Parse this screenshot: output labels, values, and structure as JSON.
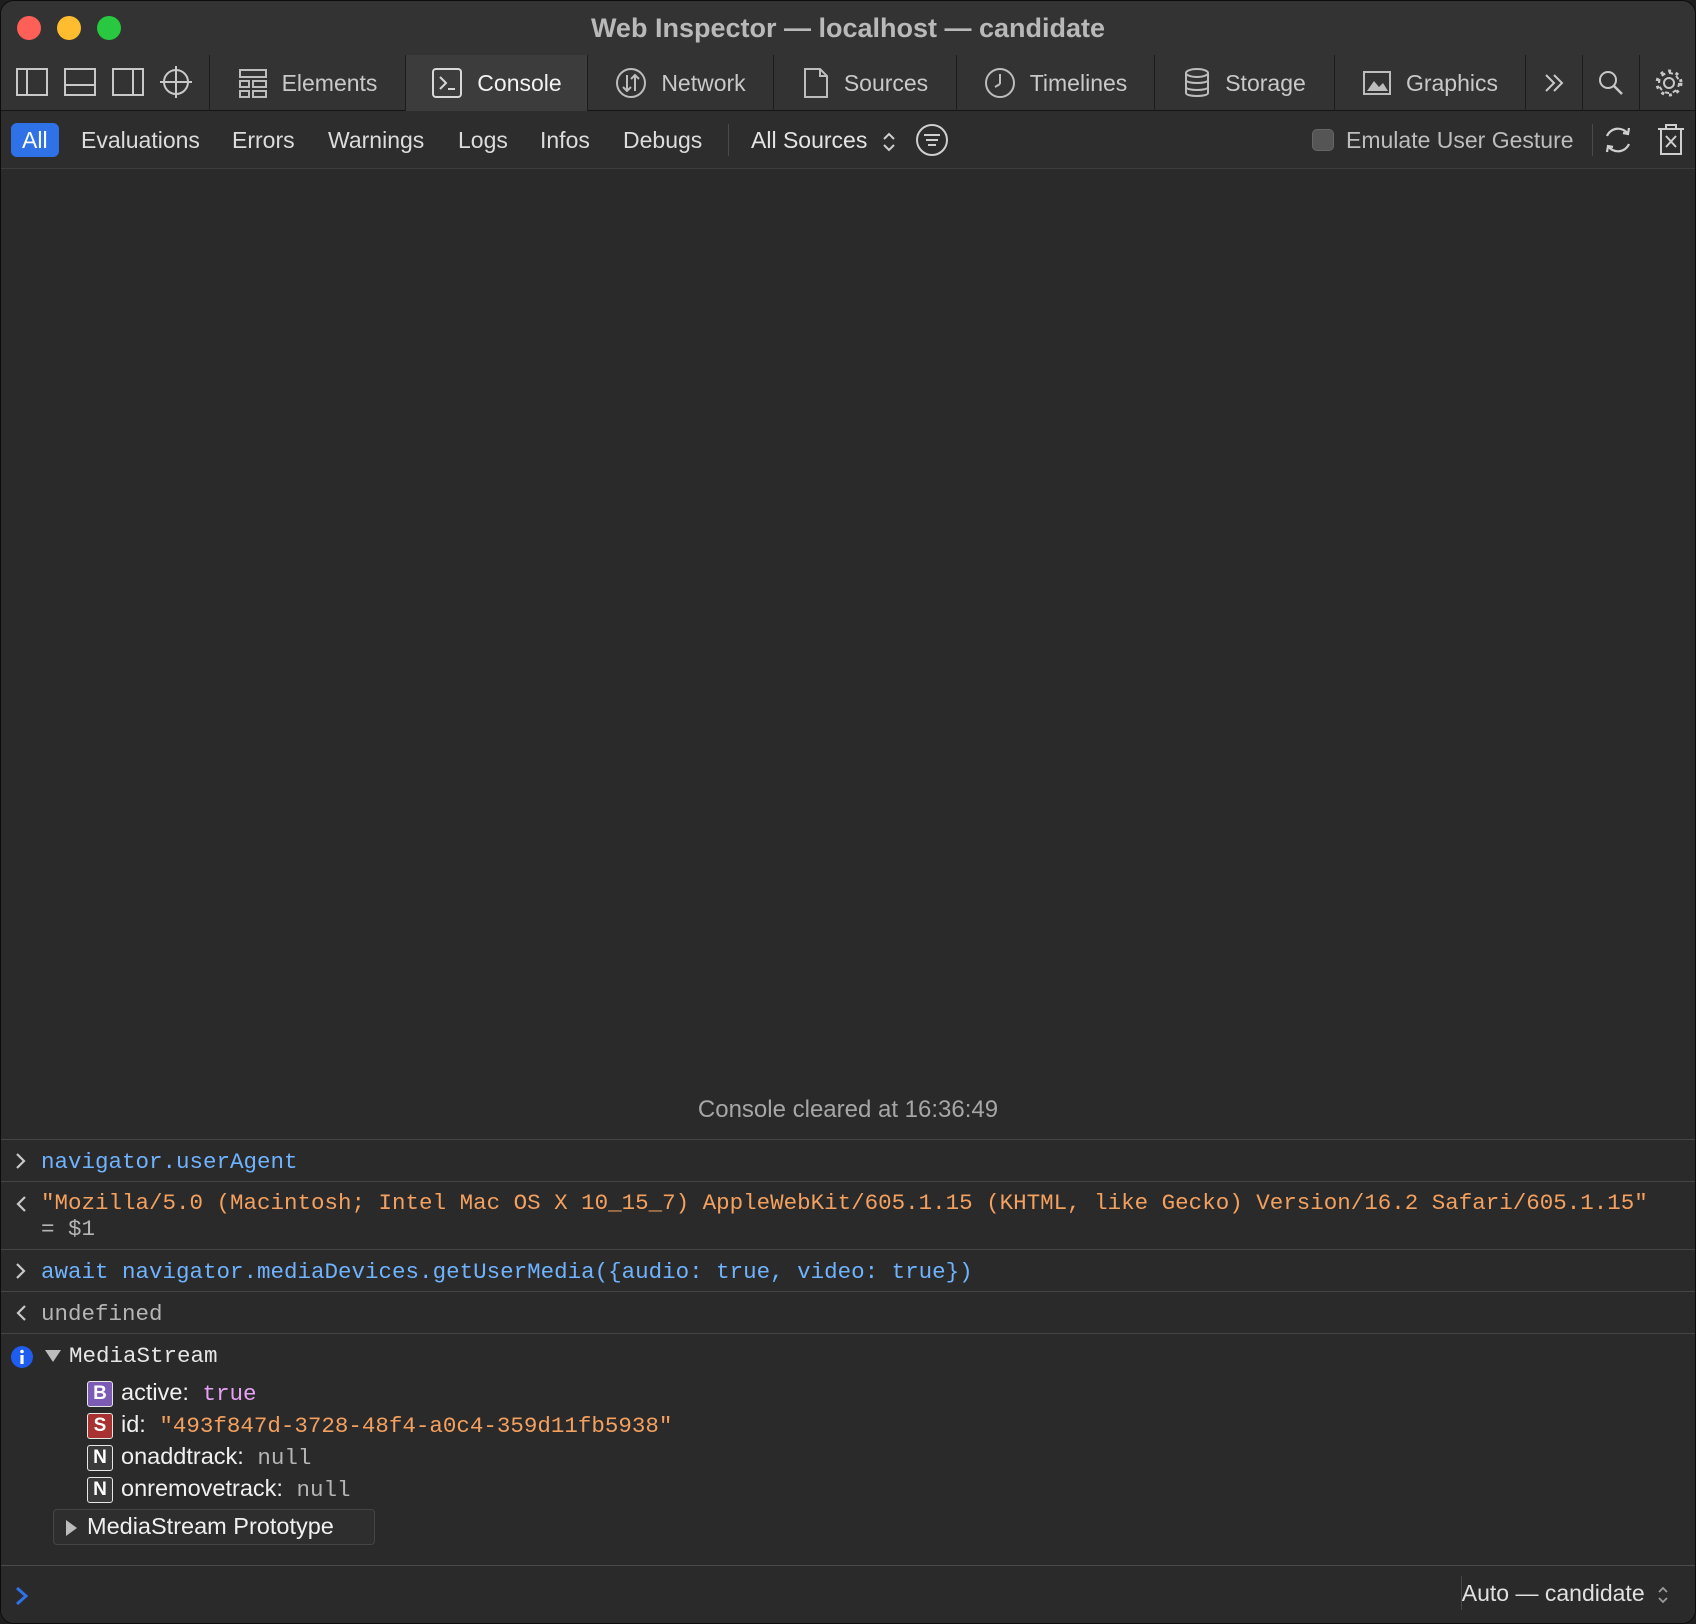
{
  "window": {
    "title": "Web Inspector — localhost — candidate"
  },
  "tabs": [
    {
      "label": "Elements",
      "icon": "elements-icon"
    },
    {
      "label": "Console",
      "icon": "console-icon",
      "active": true
    },
    {
      "label": "Network",
      "icon": "network-icon"
    },
    {
      "label": "Sources",
      "icon": "sources-icon"
    },
    {
      "label": "Timelines",
      "icon": "timelines-icon"
    },
    {
      "label": "Storage",
      "icon": "storage-icon"
    },
    {
      "label": "Graphics",
      "icon": "graphics-icon"
    }
  ],
  "filters": {
    "all": "All",
    "evaluations": "Evaluations",
    "errors": "Errors",
    "warnings": "Warnings",
    "logs": "Logs",
    "infos": "Infos",
    "debugs": "Debugs",
    "sources": "All Sources",
    "emulate": "Emulate User Gesture"
  },
  "console": {
    "cleared": "Console cleared at 16:36:49",
    "entries": {
      "input1": "navigator.userAgent",
      "output1": "\"Mozilla/5.0 (Macintosh; Intel Mac OS X 10_15_7) AppleWebKit/605.1.15 (KHTML, like Gecko) Version/16.2 Safari/605.1.15\"",
      "output1_eq": "=",
      "output1_var": "$1",
      "input2": "await navigator.mediaDevices.getUserMedia({audio: true, video: true})",
      "output2": "undefined",
      "object_name": "MediaStream",
      "props": [
        {
          "badge": "B",
          "key": "active:",
          "value": "true"
        },
        {
          "badge": "S",
          "key": "id:",
          "value": "\"493f847d-3728-48f4-a0c4-359d11fb5938\""
        },
        {
          "badge": "N",
          "key": "onaddtrack:",
          "value": "null"
        },
        {
          "badge": "N",
          "key": "onremovetrack:",
          "value": "null"
        }
      ],
      "prototype": "MediaStream Prototype"
    }
  },
  "prompt": {
    "context": "Auto — candidate"
  },
  "colors": {
    "accent": "#2f72e8",
    "string": "#f4a05f",
    "code": "#6fb3ff"
  }
}
